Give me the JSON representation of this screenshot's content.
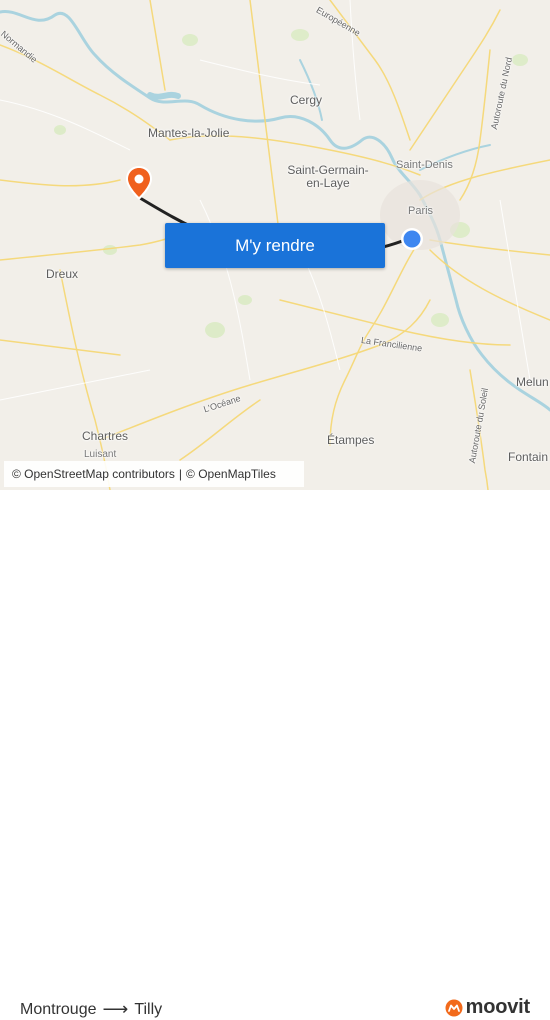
{
  "map": {
    "labels": {
      "normandie": "Normandie",
      "europeenne": "Européenne",
      "autoroute_nord": "Autoroute du Nord",
      "cergy": "Cergy",
      "mantes": "Mantes-la-Jolie",
      "saint_denis": "Saint-Denis",
      "saint_germain_1": "Saint-Germain-",
      "saint_germain_2": "en-Laye",
      "paris": "Paris",
      "dreux": "Dreux",
      "francilienne": "La Francilienne",
      "oceane": "L'Océane",
      "melun": "Melun",
      "autoroute_soleil": "Autoroute du Soleil",
      "etampes": "Étampes",
      "chartres": "Chartres",
      "luisant": "Luisant",
      "fontainebleau": "Fontain"
    },
    "colors": {
      "land": "#f2efe9",
      "water": "#aad3df",
      "road": "#fbe69a",
      "green": "#cfe8b0",
      "origin": "#1a73e8",
      "destination": "#f26a1b"
    }
  },
  "cta": {
    "label": "M'y rendre"
  },
  "attribution": {
    "osm": "© OpenStreetMap contributors",
    "sep": "|",
    "tiles": "© OpenMapTiles"
  },
  "route": {
    "origin": "Montrouge",
    "arrow": "⟶",
    "destination": "Tilly"
  },
  "brand": {
    "name": "moovit",
    "icon": "moovit-logo-icon"
  }
}
